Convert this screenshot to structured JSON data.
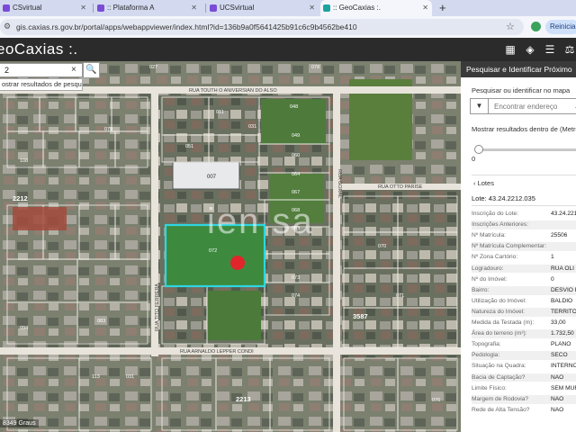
{
  "browser": {
    "tabs": [
      {
        "label": "CSvirtual",
        "active": false
      },
      {
        "label": ":: Plataforma A",
        "active": false
      },
      {
        "label": "UCSvirtual",
        "active": false
      },
      {
        "label": ":: GeoCaxias :.",
        "active": true
      }
    ],
    "new_tab_label": "+",
    "url": "gis.caxias.rs.gov.br/portal/apps/webappviewer/index.html?id=136b9a0f5641425b91c6c9b4562be410",
    "profile_button": "Reinicia"
  },
  "app": {
    "title": "eoCaxias :.",
    "header_icons": [
      "grid-icon",
      "layers-icon",
      "list-icon",
      "measure-icon"
    ]
  },
  "map": {
    "search": {
      "value": "2",
      "clear_label": "×",
      "hint": "ostrar resultados de pesquis..."
    },
    "watermark": "ien sa",
    "scale_text": "8349 Graus",
    "streets": {
      "top": "RUA TOUTH O ANIVERSIAN DO ALSO",
      "left_vertical": "RUA TITO FERRERA",
      "right_vertical": "RUA GORAL",
      "right_horizontal": "RUA OTTO PARISE",
      "bottom": "RUA ARNALDO LEPPER CONDI"
    },
    "lot_labels": [
      "011",
      "027",
      "031",
      "048",
      "049",
      "051",
      "060",
      "064",
      "067",
      "068",
      "069",
      "070",
      "071",
      "072",
      "073",
      "074",
      "076",
      "078",
      "079",
      "083",
      "094",
      "108",
      "113",
      "137",
      "2212",
      "2213",
      "3587",
      "024",
      "031"
    ],
    "big_labels": [
      "2212",
      "2213",
      "3587",
      "007"
    ]
  },
  "panel": {
    "title": "Pesquisar e Identificar Próximo",
    "search_prompt": "Pesquisar ou identificar no mapa",
    "address_placeholder": "Encontrar endereço",
    "distance_label": "Mostrar resultados dentro de (Metros)",
    "distance_value": "0",
    "back_label": "Lotes",
    "lote_id": "Lote: 43.24.2212.035",
    "attributes": [
      {
        "label": "Inscrição do Lote:",
        "value": "43.24.221"
      },
      {
        "label": "Inscrições Anteriores:",
        "value": ""
      },
      {
        "label": "Nº Matrícula:",
        "value": "25506"
      },
      {
        "label": "Nº Matrícula Complementar:",
        "value": ""
      },
      {
        "label": "Nº Zona Cartório:",
        "value": "1"
      },
      {
        "label": "Logradouro:",
        "value": "RUA OLI"
      },
      {
        "label": "Nº do Imóvel:",
        "value": "0"
      },
      {
        "label": "Bairro:",
        "value": "DESVIO R"
      },
      {
        "label": "Utilização do Imóvel:",
        "value": "BALDIO"
      },
      {
        "label": "Natureza do Imóvel:",
        "value": "TERRITOR"
      },
      {
        "label": "Medida da Testada (m):",
        "value": "33,00"
      },
      {
        "label": "Área do terreno (m²):",
        "value": "1.732,50"
      },
      {
        "label": "Topografia:",
        "value": "PLANO"
      },
      {
        "label": "Pedologia:",
        "value": "SECO"
      },
      {
        "label": "Situação na Quadra:",
        "value": "INTERNO"
      },
      {
        "label": "Bacia de Captação?",
        "value": "NAO"
      },
      {
        "label": "Limite Físico:",
        "value": "SEM MUR"
      },
      {
        "label": "Margem de Rodovia?",
        "value": "NAO"
      },
      {
        "label": "Rede de Alta Tensão?",
        "value": "NAO"
      }
    ]
  },
  "colors": {
    "header_bg": "#2b2b2b",
    "selected_parcel": "#2fd6e0",
    "marker": "#e0262a",
    "road": "#e8e4dc"
  }
}
